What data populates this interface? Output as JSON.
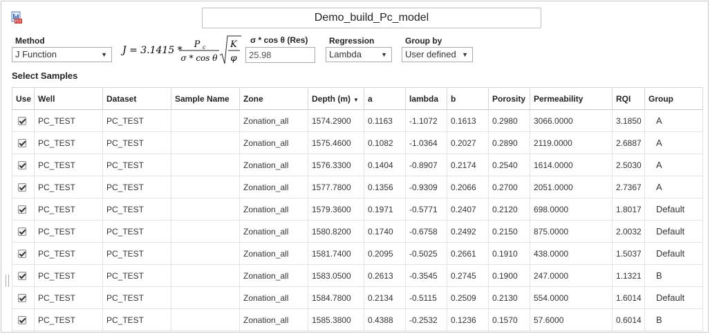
{
  "app": {
    "icon": "pdf-chart-icon",
    "title": "Demo_build_Pc_model"
  },
  "controls": {
    "method": {
      "label": "Method",
      "value": "J Function"
    },
    "formula": {
      "lhs": "J = 3.1415 *",
      "numerator": "P",
      "numerator_sub": "c",
      "denominator": "σ * cos θ",
      "root_num": "K",
      "root_den": "φ"
    },
    "sigma": {
      "label": "σ * cos θ (Res)",
      "value": "25.98"
    },
    "regression": {
      "label": "Regression",
      "value": "Lambda"
    },
    "group_by": {
      "label": "Group by",
      "value": "User defined"
    }
  },
  "samples": {
    "section_title": "Select Samples",
    "columns": [
      "Use",
      "Well",
      "Dataset",
      "Sample Name",
      "Zone",
      "Depth (m)",
      "a",
      "lambda",
      "b",
      "Porosity",
      "Permeability",
      "RQI",
      "Group"
    ],
    "rows": [
      {
        "use": true,
        "well": "PC_TEST",
        "dataset": "PC_TEST",
        "sample_name": "",
        "zone": "Zonation_all",
        "depth": "1574.2900",
        "a": "0.1163",
        "lambda": "-1.1072",
        "b": "0.1613",
        "porosity": "0.2980",
        "permeability": "3066.0000",
        "rqi": "3.1850",
        "group": "A"
      },
      {
        "use": true,
        "well": "PC_TEST",
        "dataset": "PC_TEST",
        "sample_name": "",
        "zone": "Zonation_all",
        "depth": "1575.4600",
        "a": "0.1082",
        "lambda": "-1.0364",
        "b": "0.2027",
        "porosity": "0.2890",
        "permeability": "2119.0000",
        "rqi": "2.6887",
        "group": "A"
      },
      {
        "use": true,
        "well": "PC_TEST",
        "dataset": "PC_TEST",
        "sample_name": "",
        "zone": "Zonation_all",
        "depth": "1576.3300",
        "a": "0.1404",
        "lambda": "-0.8907",
        "b": "0.2174",
        "porosity": "0.2540",
        "permeability": "1614.0000",
        "rqi": "2.5030",
        "group": "A"
      },
      {
        "use": true,
        "well": "PC_TEST",
        "dataset": "PC_TEST",
        "sample_name": "",
        "zone": "Zonation_all",
        "depth": "1577.7800",
        "a": "0.1356",
        "lambda": "-0.9309",
        "b": "0.2066",
        "porosity": "0.2700",
        "permeability": "2051.0000",
        "rqi": "2.7367",
        "group": "A"
      },
      {
        "use": true,
        "well": "PC_TEST",
        "dataset": "PC_TEST",
        "sample_name": "",
        "zone": "Zonation_all",
        "depth": "1579.3600",
        "a": "0.1971",
        "lambda": "-0.5771",
        "b": "0.2407",
        "porosity": "0.2120",
        "permeability": "698.0000",
        "rqi": "1.8017",
        "group": "Default"
      },
      {
        "use": true,
        "well": "PC_TEST",
        "dataset": "PC_TEST",
        "sample_name": "",
        "zone": "Zonation_all",
        "depth": "1580.8200",
        "a": "0.1740",
        "lambda": "-0.6758",
        "b": "0.2492",
        "porosity": "0.2150",
        "permeability": "875.0000",
        "rqi": "2.0032",
        "group": "Default"
      },
      {
        "use": true,
        "well": "PC_TEST",
        "dataset": "PC_TEST",
        "sample_name": "",
        "zone": "Zonation_all",
        "depth": "1581.7400",
        "a": "0.2095",
        "lambda": "-0.5025",
        "b": "0.2661",
        "porosity": "0.1910",
        "permeability": "438.0000",
        "rqi": "1.5037",
        "group": "Default"
      },
      {
        "use": true,
        "well": "PC_TEST",
        "dataset": "PC_TEST",
        "sample_name": "",
        "zone": "Zonation_all",
        "depth": "1583.0500",
        "a": "0.2613",
        "lambda": "-0.3545",
        "b": "0.2745",
        "porosity": "0.1900",
        "permeability": "247.0000",
        "rqi": "1.1321",
        "group": "B"
      },
      {
        "use": true,
        "well": "PC_TEST",
        "dataset": "PC_TEST",
        "sample_name": "",
        "zone": "Zonation_all",
        "depth": "1584.7800",
        "a": "0.2134",
        "lambda": "-0.5115",
        "b": "0.2509",
        "porosity": "0.2130",
        "permeability": "554.0000",
        "rqi": "1.6014",
        "group": "Default"
      },
      {
        "use": true,
        "well": "PC_TEST",
        "dataset": "PC_TEST",
        "sample_name": "",
        "zone": "Zonation_all",
        "depth": "1585.3800",
        "a": "0.4388",
        "lambda": "-0.2532",
        "b": "0.1236",
        "porosity": "0.1570",
        "permeability": "57.6000",
        "rqi": "0.6014",
        "group": "B"
      }
    ]
  }
}
